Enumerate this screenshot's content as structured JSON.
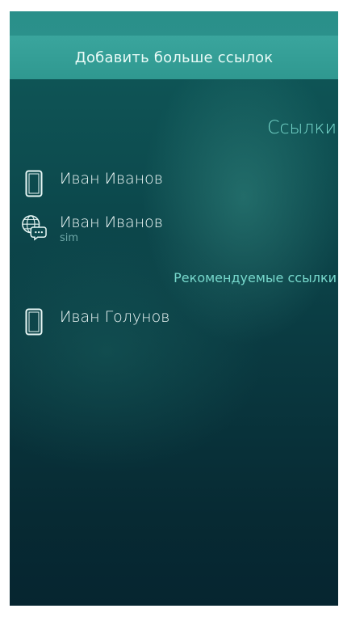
{
  "header": {
    "add_more_links": "Добавить больше ссылок"
  },
  "links": {
    "title": "Ссылки",
    "items": [
      {
        "name": "Иван Иванов",
        "sub": "",
        "icon": "phone-icon"
      },
      {
        "name": "Иван Иванов",
        "sub": "sim",
        "icon": "globe-chat-icon"
      }
    ]
  },
  "recommended": {
    "title": "Рекомендуемые ссылки",
    "items": [
      {
        "name": "Иван Голунов",
        "icon": "phone-icon"
      }
    ]
  },
  "colors": {
    "accent": "#77d8cc",
    "header_bg": "#35a097",
    "background_top": "#0f5a5a",
    "background_bottom": "#062530"
  }
}
